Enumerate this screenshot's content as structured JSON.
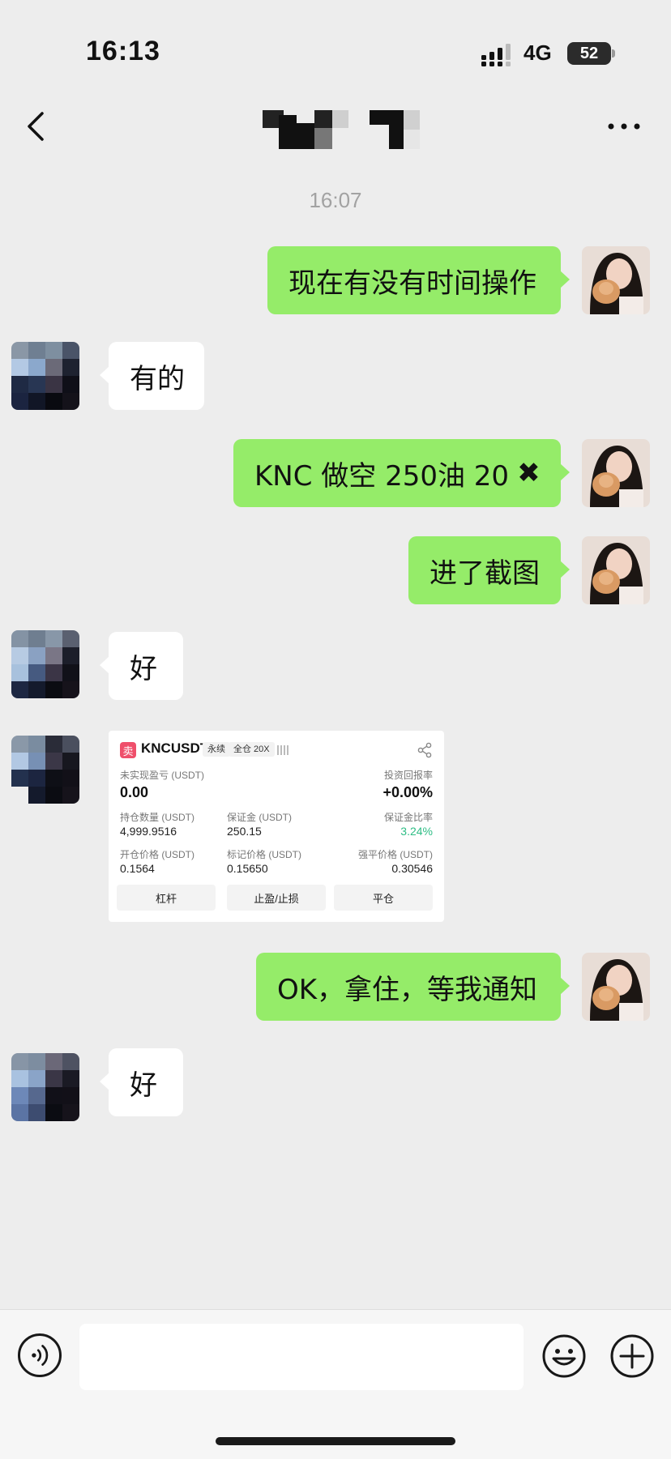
{
  "status_bar": {
    "time": "16:13",
    "network": "4G",
    "battery": "52"
  },
  "nav": {
    "title_icon": "pixelated-contact-name",
    "back_icon": "chevron-left-icon",
    "more_icon": "more-dots-icon"
  },
  "timestamp": "16:07",
  "messages": [
    {
      "side": "out",
      "text": "现在有没有时间操作"
    },
    {
      "side": "in",
      "text": "有的"
    },
    {
      "side": "out",
      "text": "KNC 做空 250油 20"
    },
    {
      "side": "out",
      "text": "进了截图"
    },
    {
      "side": "in",
      "text": "好"
    },
    {
      "side": "in",
      "type": "image"
    },
    {
      "side": "out",
      "text": "OK，拿住，等我通知"
    },
    {
      "side": "in",
      "text": "好"
    }
  ],
  "cross_mark": "✖",
  "position_card": {
    "side_icon": "卖",
    "symbol": "KNCUSDT",
    "tag_type": "永续",
    "tag_margin": "全仓 20X",
    "unrealized_label": "未实现盈亏 (USDT)",
    "unrealized_value": "0.00",
    "roi_label": "投资回报率",
    "roi_value": "+0.00%",
    "size_label": "持仓数量 (USDT)",
    "size_value": "4,999.9516",
    "margin_label": "保证金 (USDT)",
    "margin_value": "250.15",
    "margin_ratio_label": "保证金比率",
    "margin_ratio_value": "3.24%",
    "entry_label": "开仓价格 (USDT)",
    "entry_value": "0.1564",
    "mark_label": "标记价格 (USDT)",
    "mark_value": "0.15650",
    "liq_label": "强平价格 (USDT)",
    "liq_value": "0.30546",
    "btn_leverage": "杠杆",
    "btn_tpsl": "止盈/止损",
    "btn_close": "平仓",
    "colors": {
      "sell": "#ef4f6b",
      "positive": "#2ebd85"
    }
  },
  "input": {
    "placeholder": ""
  },
  "colors": {
    "outgoing_bubble": "#95ec69",
    "incoming_bubble": "#ffffff",
    "background": "#ededed"
  }
}
